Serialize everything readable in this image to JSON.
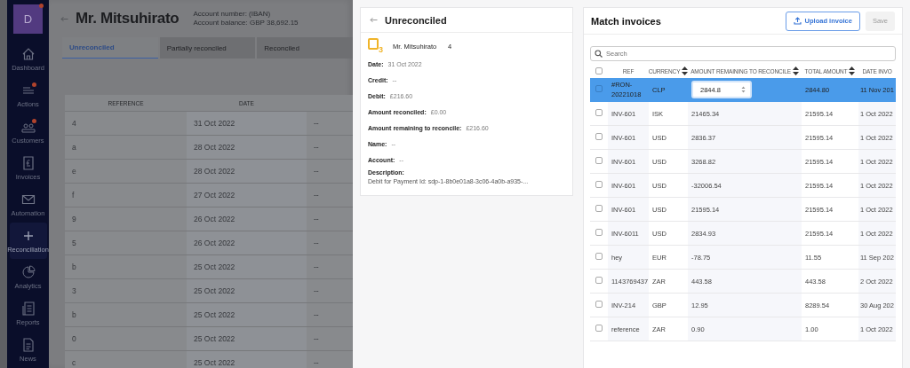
{
  "sidebar": {
    "avatar": "D",
    "avatar_notification": true,
    "items": [
      {
        "kind": "home",
        "label": "Dashboard",
        "badge": false,
        "selected": false
      },
      {
        "kind": "list",
        "label": "Actions",
        "badge": true,
        "selected": false
      },
      {
        "kind": "people",
        "label": "Customers",
        "badge": true,
        "selected": false
      },
      {
        "kind": "receipt",
        "label": "Invoices",
        "badge": false,
        "selected": false
      },
      {
        "kind": "envelope",
        "label": "Automation",
        "badge": false,
        "selected": false
      },
      {
        "kind": "plus",
        "label": "Reconciliation",
        "badge": false,
        "selected": true
      },
      {
        "kind": "pie",
        "label": "Analytics",
        "badge": false,
        "selected": false
      },
      {
        "kind": "report",
        "label": "Reports",
        "badge": false,
        "selected": false
      },
      {
        "kind": "document",
        "label": "News",
        "badge": false,
        "selected": false
      }
    ]
  },
  "account": {
    "title": "Mr. Mitsuhirato",
    "account_number": "Account number: (IBAN)",
    "balance": "Account balance: GBP 38,692.15"
  },
  "tabs": [
    {
      "label": "Unreconciled",
      "selected": true
    },
    {
      "label": "Partially reconciled",
      "selected": false
    },
    {
      "label": "Reconciled",
      "selected": false
    }
  ],
  "transactions": {
    "columns": [
      "REFERENCE",
      "DATE"
    ],
    "rows": [
      {
        "reference": "4",
        "date": "31 Oct 2022",
        "column_3": "--"
      },
      {
        "reference": "a",
        "date": "28 Oct 2022",
        "column_3": "--"
      },
      {
        "reference": "e",
        "date": "28 Oct 2022",
        "column_3": "--"
      },
      {
        "reference": "f",
        "date": "27 Oct 2022",
        "column_3": "--"
      },
      {
        "reference": "9",
        "date": "26 Oct 2022",
        "column_3": "--"
      },
      {
        "reference": "5",
        "date": "26 Oct 2022",
        "column_3": "--"
      },
      {
        "reference": "b",
        "date": "25 Oct 2022",
        "column_3": "--"
      },
      {
        "reference": "3",
        "date": "25 Oct 2022",
        "column_3": "--"
      },
      {
        "reference": "b",
        "date": "25 Oct 2022",
        "column_3": "--"
      },
      {
        "reference": "0",
        "date": "25 Oct 2022",
        "column_3": "--"
      },
      {
        "reference": "c",
        "date": "25 Oct 2022",
        "column_3": "--"
      }
    ]
  },
  "detail": {
    "title": "Unreconciled",
    "icon_count": "3",
    "name": "Mr. Mitsuhirato",
    "reference": "4",
    "fields": [
      {
        "label": "Date:",
        "value": "31 Oct 2022"
      },
      {
        "label": "Credit:",
        "value": "--"
      },
      {
        "label": "Debit:",
        "value": "£216.60"
      },
      {
        "label": "Amount reconciled:",
        "value": "£0.00"
      },
      {
        "label": "Amount remaining to reconcile:",
        "value": "£216.60"
      },
      {
        "label": "Name:",
        "value": "--"
      },
      {
        "label": "Account:",
        "value": "--"
      }
    ],
    "description": {
      "label": "Description:",
      "value": "Debit for Payment Id: sdp-1-8b0e01a8-3c06-4a0b-a935-..."
    }
  },
  "match": {
    "title": "Match invoices",
    "upload_button": "Upload invoice",
    "save_button": {
      "label": "Save",
      "disabled": true
    },
    "search": {
      "placeholder": "Search"
    },
    "select_all": {
      "checked": false
    },
    "columns": [
      {
        "label": "REF",
        "sortable": false
      },
      {
        "label": "CURRENCY",
        "sortable": true
      },
      {
        "label": "AMOUNT REMAINING TO RECONCILE",
        "sortable": true
      },
      {
        "label": "TOTAL AMOUNT",
        "sortable": true
      },
      {
        "label": "DATE INVO",
        "sortable": false
      }
    ],
    "rows": [
      {
        "ref": "#RON-20221018",
        "currency": "CLP",
        "amount": "2844.8",
        "total": "2844.80",
        "date": "11 Nov 201",
        "selected": true,
        "checked": false
      },
      {
        "ref": "INV-601",
        "currency": "ISK",
        "amount": "21465.34",
        "total": "21595.14",
        "date": "1 Oct 2022",
        "selected": false,
        "checked": false
      },
      {
        "ref": "INV-601",
        "currency": "USD",
        "amount": "2836.37",
        "total": "21595.14",
        "date": "1 Oct 2022",
        "selected": false,
        "checked": false
      },
      {
        "ref": "INV-601",
        "currency": "USD",
        "amount": "3268.82",
        "total": "21595.14",
        "date": "1 Oct 2022",
        "selected": false,
        "checked": false
      },
      {
        "ref": "INV-601",
        "currency": "USD",
        "amount": "-32006.54",
        "total": "21595.14",
        "date": "1 Oct 2022",
        "selected": false,
        "checked": false
      },
      {
        "ref": "INV-601",
        "currency": "USD",
        "amount": "21595.14",
        "total": "21595.14",
        "date": "1 Oct 2022",
        "selected": false,
        "checked": false
      },
      {
        "ref": "INV-6011",
        "currency": "USD",
        "amount": "2834.93",
        "total": "21595.14",
        "date": "1 Oct 2022",
        "selected": false,
        "checked": false
      },
      {
        "ref": "hey",
        "currency": "EUR",
        "amount": "-78.75",
        "total": "11.55",
        "date": "11 Sep 202",
        "selected": false,
        "checked": false
      },
      {
        "ref": "1143769437",
        "currency": "ZAR",
        "amount": "443.58",
        "total": "443.58",
        "date": "2 Oct 2022",
        "selected": false,
        "checked": false
      },
      {
        "ref": "INV-214",
        "currency": "GBP",
        "amount": "12.95",
        "total": "8289.54",
        "date": "30 Aug 202",
        "selected": false,
        "checked": false
      },
      {
        "ref": "reference",
        "currency": "ZAR",
        "amount": "0.90",
        "total": "1.00",
        "date": "1 Oct 2022",
        "selected": false,
        "checked": false
      }
    ]
  }
}
